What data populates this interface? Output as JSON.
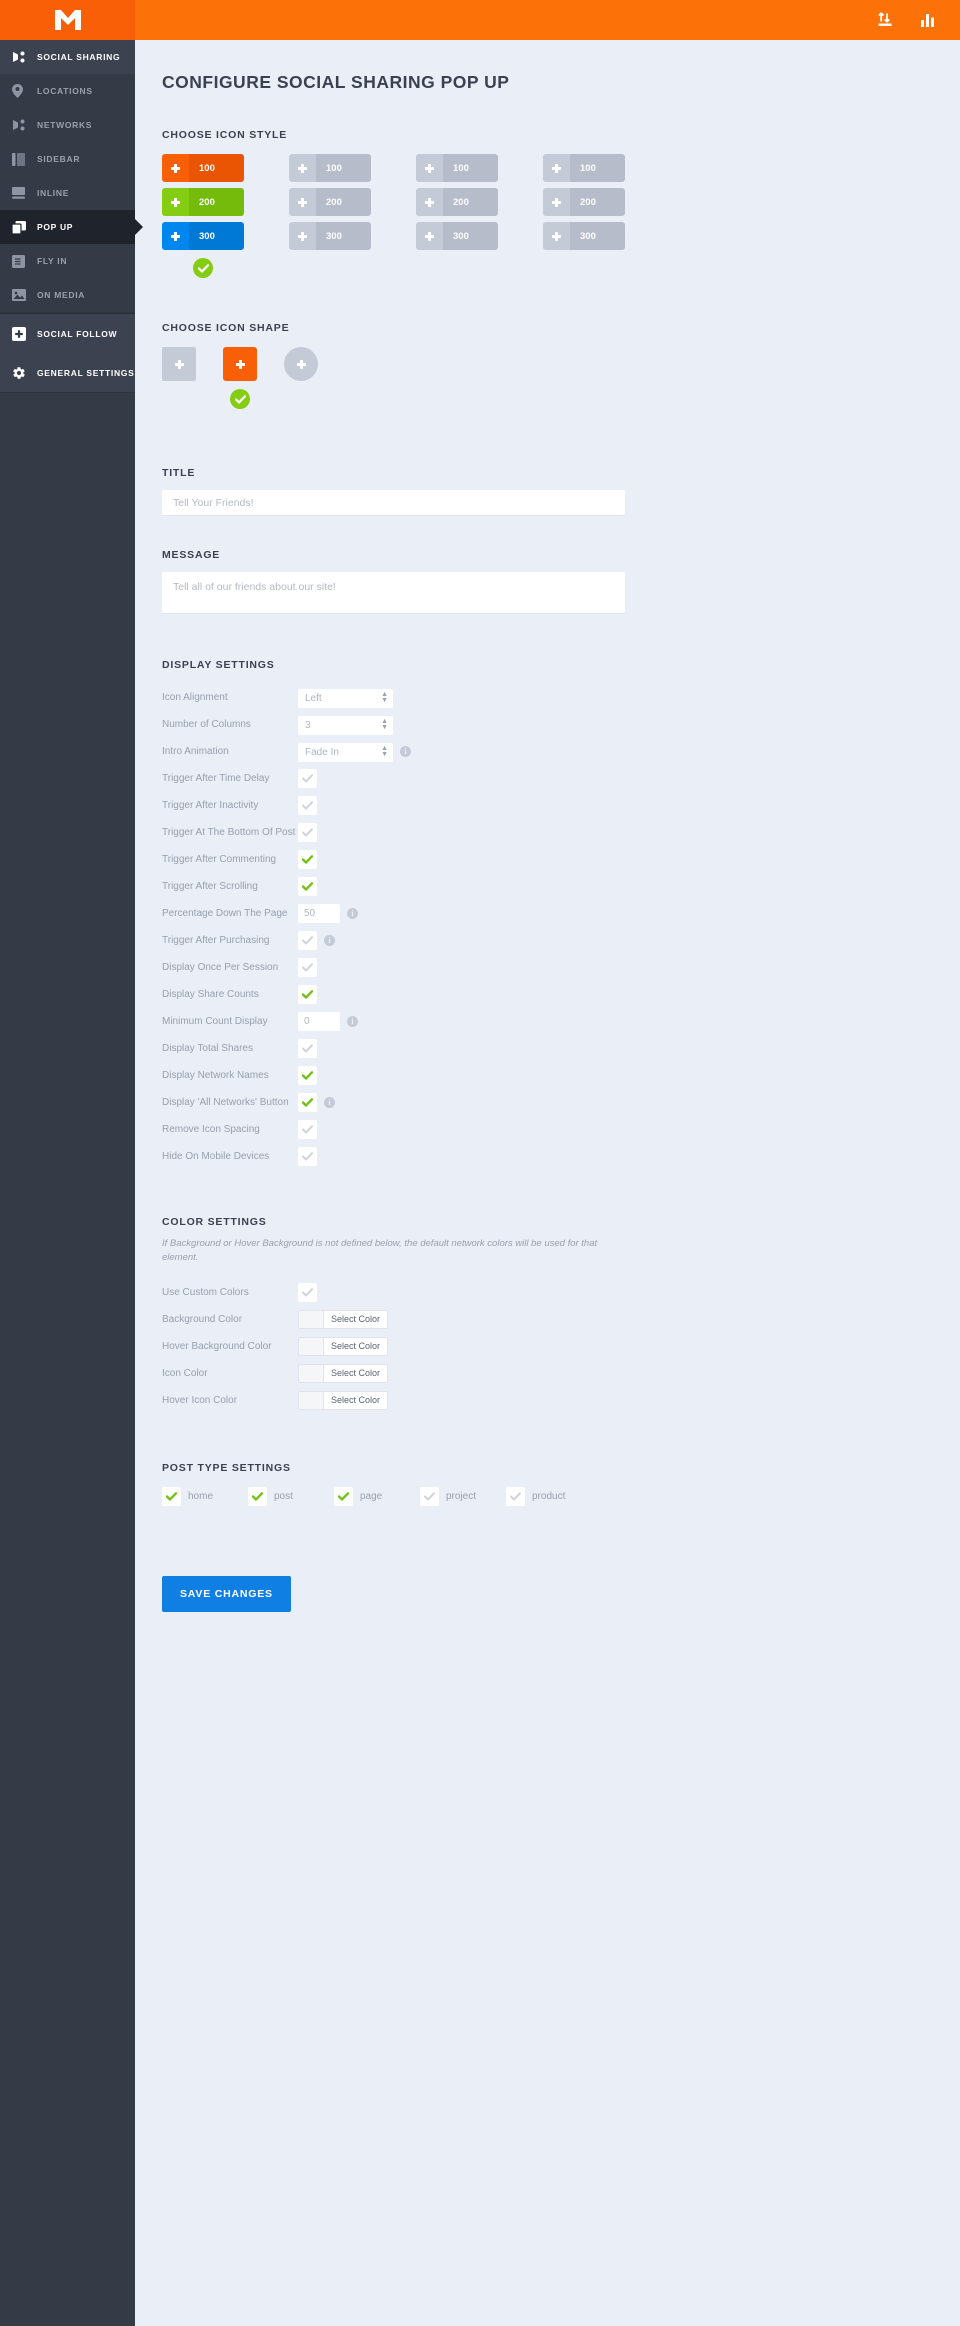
{
  "brand": {
    "logo_icon": "m-logo-icon"
  },
  "topbar": {
    "icons": [
      {
        "name": "import-export-icon",
        "glyph": "⇅"
      },
      {
        "name": "analytics-bar-chart-icon",
        "glyph": "▮"
      }
    ]
  },
  "sidebar": {
    "groups": [
      {
        "items": [
          {
            "label": "Social Sharing",
            "icon": "share-icon",
            "state": "active"
          },
          {
            "label": "Locations",
            "icon": "location-pin-icon",
            "state": "normal"
          },
          {
            "label": "Networks",
            "icon": "share-icon",
            "state": "normal"
          },
          {
            "label": "Sidebar",
            "icon": "sidebar-panel-icon",
            "state": "normal"
          },
          {
            "label": "Inline",
            "icon": "inline-bar-icon",
            "state": "normal"
          },
          {
            "label": "Pop Up",
            "icon": "popup-windows-icon",
            "state": "current"
          },
          {
            "label": "Fly In",
            "icon": "fly-in-icon",
            "state": "normal"
          },
          {
            "label": "On Media",
            "icon": "image-media-icon",
            "state": "normal"
          }
        ]
      },
      {
        "items": [
          {
            "label": "Social Follow",
            "icon": "plus-square-icon",
            "state": "active"
          },
          {
            "label": "General Settings",
            "icon": "gear-icon",
            "state": "active"
          }
        ]
      }
    ]
  },
  "page": {
    "title": "Configure Social Sharing Pop Up"
  },
  "icon_style": {
    "heading": "Choose Icon Style",
    "columns": [
      {
        "selected": true,
        "buttons": [
          {
            "count": "100",
            "color": "#f95f06",
            "variant": "orange"
          },
          {
            "count": "200",
            "color": "#84cd13",
            "variant": "green"
          },
          {
            "count": "300",
            "color": "#0087ef",
            "variant": "blue"
          }
        ]
      },
      {
        "selected": false,
        "buttons": [
          {
            "count": "100",
            "color": "#c5cad7",
            "variant": "grey"
          },
          {
            "count": "200",
            "color": "#c5cad7",
            "variant": "grey"
          },
          {
            "count": "300",
            "color": "#c5cad7",
            "variant": "grey"
          }
        ]
      },
      {
        "selected": false,
        "buttons": [
          {
            "count": "100",
            "color": "#c5cad7",
            "variant": "grey"
          },
          {
            "count": "200",
            "color": "#c5cad7",
            "variant": "grey"
          },
          {
            "count": "300",
            "color": "#c5cad7",
            "variant": "grey"
          }
        ]
      },
      {
        "selected": false,
        "buttons": [
          {
            "count": "100",
            "color": "#c5cad7",
            "variant": "grey"
          },
          {
            "count": "200",
            "color": "#c5cad7",
            "variant": "grey"
          },
          {
            "count": "300",
            "color": "#c5cad7",
            "variant": "grey"
          }
        ]
      }
    ]
  },
  "icon_shape": {
    "heading": "Choose Icon Shape",
    "options": [
      {
        "shape": "square",
        "selected": false
      },
      {
        "shape": "rounded",
        "selected": true
      },
      {
        "shape": "circle",
        "selected": false
      }
    ]
  },
  "title_field": {
    "label": "Title",
    "value": "",
    "placeholder": "Tell Your Friends!"
  },
  "message_field": {
    "label": "Message",
    "value": "",
    "placeholder": "Tell all of our friends about our site!"
  },
  "display_settings": {
    "heading": "Display Settings",
    "rows": [
      {
        "label": "Icon Alignment",
        "type": "select",
        "value": "Left",
        "info": false
      },
      {
        "label": "Number of Columns",
        "type": "select",
        "value": "3",
        "info": false
      },
      {
        "label": "Intro Animation",
        "type": "select",
        "value": "Fade In",
        "info": true
      },
      {
        "label": "Trigger After Time Delay",
        "type": "checkbox",
        "checked": false,
        "info": false
      },
      {
        "label": "Trigger After Inactivity",
        "type": "checkbox",
        "checked": false,
        "info": false
      },
      {
        "label": "Trigger At The Bottom Of Post",
        "type": "checkbox",
        "checked": false,
        "info": false
      },
      {
        "label": "Trigger After Commenting",
        "type": "checkbox",
        "checked": true,
        "info": false
      },
      {
        "label": "Trigger After Scrolling",
        "type": "checkbox",
        "checked": true,
        "info": false
      },
      {
        "label": "Percentage Down The Page",
        "type": "number",
        "value": "50",
        "info": true
      },
      {
        "label": "Trigger After Purchasing",
        "type": "checkbox",
        "checked": false,
        "info": true
      },
      {
        "label": "Display Once Per Session",
        "type": "checkbox",
        "checked": false,
        "info": false
      },
      {
        "label": "Display Share Counts",
        "type": "checkbox",
        "checked": true,
        "info": false
      },
      {
        "label": "Minimum Count Display",
        "type": "number",
        "value": "0",
        "info": true
      },
      {
        "label": "Display Total Shares",
        "type": "checkbox",
        "checked": false,
        "info": false
      },
      {
        "label": "Display Network Names",
        "type": "checkbox",
        "checked": true,
        "info": false
      },
      {
        "label": "Display 'All Networks' Button",
        "type": "checkbox",
        "checked": true,
        "info": true
      },
      {
        "label": "Remove Icon Spacing",
        "type": "checkbox",
        "checked": false,
        "info": false
      },
      {
        "label": "Hide On Mobile Devices",
        "type": "checkbox",
        "checked": false,
        "info": false
      }
    ]
  },
  "color_settings": {
    "heading": "Color Settings",
    "note": "If Background or Hover Background is not defined below, the default network colors will be used for that element.",
    "rows": [
      {
        "label": "Use Custom Colors",
        "type": "checkbox",
        "checked": false
      },
      {
        "label": "Background Color",
        "type": "color",
        "button": "Select Color"
      },
      {
        "label": "Hover Background Color",
        "type": "color",
        "button": "Select Color"
      },
      {
        "label": "Icon Color",
        "type": "color",
        "button": "Select Color"
      },
      {
        "label": "Hover Icon Color",
        "type": "color",
        "button": "Select Color"
      }
    ]
  },
  "post_type_settings": {
    "heading": "Post Type Settings",
    "items": [
      {
        "label": "home",
        "checked": true
      },
      {
        "label": "post",
        "checked": true
      },
      {
        "label": "page",
        "checked": true
      },
      {
        "label": "project",
        "checked": false
      },
      {
        "label": "product",
        "checked": false
      }
    ]
  },
  "save_button": {
    "label": "Save Changes"
  },
  "colors": {
    "brand_orange": "#f95f06",
    "topbar_orange": "#fc7208",
    "sidebar_bg": "#353a47",
    "sidebar_current": "#1f232c",
    "page_bg": "#eaeef6",
    "accent_green": "#84cd13",
    "accent_blue": "#0087ef",
    "save_blue": "#0f7fe4",
    "muted_grey": "#c5cad7"
  }
}
